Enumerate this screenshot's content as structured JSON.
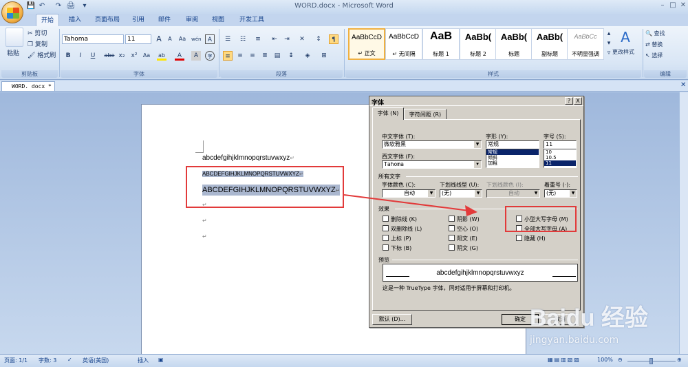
{
  "app": {
    "title": "WORD.docx - Microsoft Word"
  },
  "quick_access": {
    "save": "💾",
    "undo": "↶",
    "redo": "↷",
    "print": "🖨",
    "more": "▾"
  },
  "tabs": [
    "开始",
    "插入",
    "页面布局",
    "引用",
    "邮件",
    "审阅",
    "视图",
    "开发工具"
  ],
  "ribbon": {
    "clipboard": {
      "paste": "粘贴",
      "cut": "剪切",
      "copy": "复制",
      "format_painter": "格式刷",
      "label": "剪贴板"
    },
    "font": {
      "name": "Tahoma",
      "size": "11",
      "label": "字体",
      "grow": "A",
      "shrink": "A",
      "clear": "Aa",
      "wen": "wén",
      "border_a": "A",
      "bold": "B",
      "italic": "I",
      "underline": "U",
      "strike": "abe",
      "sub": "x₂",
      "sup": "x²",
      "case": "Aa",
      "highlight": "ab",
      "color": "A",
      "shade": "A",
      "circle": "字"
    },
    "paragraph": {
      "label": "段落"
    },
    "styles": {
      "label": "样式",
      "items": [
        {
          "sample": "AaBbCcD",
          "name": "↵ 正文"
        },
        {
          "sample": "AaBbCcD",
          "name": "↵ 无间隔"
        },
        {
          "sample": "AaB",
          "name": "标题 1"
        },
        {
          "sample": "AaBb(",
          "name": "标题 2"
        },
        {
          "sample": "AaBb(",
          "name": "标题"
        },
        {
          "sample": "AaBb(",
          "name": "副标题"
        },
        {
          "sample": "AaBbCc",
          "name": "不明显强调"
        }
      ],
      "change": "更改样式"
    },
    "editing": {
      "find": "查找",
      "replace": "替换",
      "select": "选择",
      "label": "编辑"
    }
  },
  "document": {
    "tab_name": "WORD. docx  *",
    "lines": [
      "abcdefgihjklmnopqrstuvwxyz",
      "ABCDEFGIHJKLMNOPQRSTUVWXYZ",
      "ABCDEFGIHJKLMNOPQRSTUVWXYZ"
    ],
    "para_mark": "↵"
  },
  "dialog": {
    "title": "字体",
    "help": "?",
    "close": "X",
    "tabs": [
      "字体 (N)",
      "字符间距 (R)"
    ],
    "labels": {
      "chinese_font": "中文字体 (T):",
      "style": "字形 (Y):",
      "size": "字号 (S):",
      "western_font": "西文字体 (F):",
      "all_text": "所有文字",
      "font_color": "字体颜色 (C):",
      "underline_type": "下划线线型 (U):",
      "underline_color": "下划线颜色 (I):",
      "emphasis": "着重号 (·):",
      "effects": "效果",
      "preview": "预览"
    },
    "values": {
      "chinese_font": "微软雅黑",
      "style": "常规",
      "size": "11",
      "western_font": "Tahoma",
      "font_color": "自动",
      "underline_type": "(无)",
      "underline_color": "自动",
      "emphasis": "(无)"
    },
    "style_list": [
      "常规",
      "倾斜",
      "加粗"
    ],
    "size_list": [
      "10",
      "10.5",
      "11"
    ],
    "effects": [
      "删除线 (K)",
      "阴影 (W)",
      "小型大写字母 (M)",
      "双删除线 (L)",
      "空心 (O)",
      "全部大写字母 (A)",
      "上标 (P)",
      "阳文 (E)",
      "隐藏 (H)",
      "下标 (B)",
      "阴文 (G)"
    ],
    "preview_text": "abcdefgihjklmnopqrstuvwxyz",
    "note": "这是一种 TrueType 字体，同时适用于屏幕和打印机。",
    "buttons": {
      "default": "默认 (D)...",
      "ok": "确定",
      "cancel": "取消"
    }
  },
  "status": {
    "page": "页面: 1/1",
    "words": "字数: 3",
    "lang": "英语(美国)",
    "insert": "插入",
    "zoom": "100%"
  },
  "watermark": {
    "brand": "Baidu 经验",
    "url": "jingyan.baidu.com"
  }
}
